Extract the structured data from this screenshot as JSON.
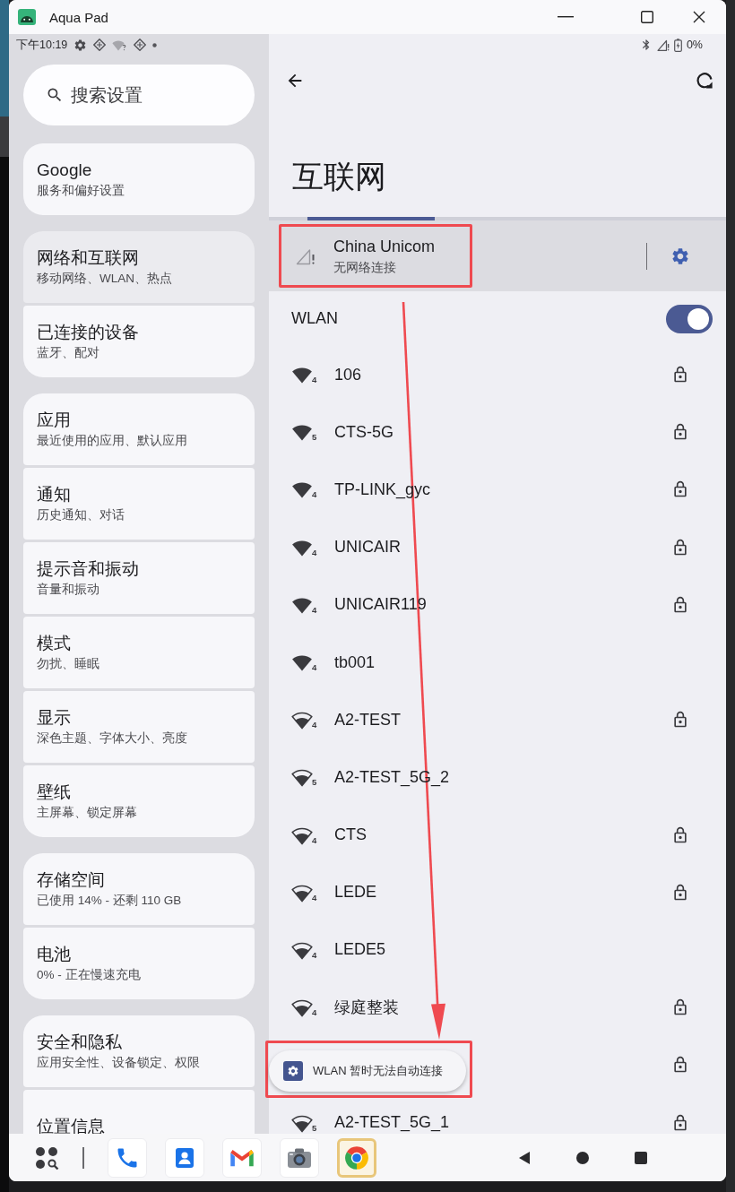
{
  "window": {
    "title": "Aqua Pad"
  },
  "status_bar": {
    "time": "下午10:19",
    "battery": "0%"
  },
  "search": {
    "placeholder": "搜索设置"
  },
  "settings_groups": [
    {
      "items": [
        {
          "title": "Google",
          "subtitle": "服务和偏好设置",
          "selected": false
        }
      ]
    },
    {
      "items": [
        {
          "title": "网络和互联网",
          "subtitle": "移动网络、WLAN、热点",
          "selected": true
        },
        {
          "title": "已连接的设备",
          "subtitle": "蓝牙、配对",
          "selected": false
        }
      ]
    },
    {
      "items": [
        {
          "title": "应用",
          "subtitle": "最近使用的应用、默认应用",
          "selected": false
        },
        {
          "title": "通知",
          "subtitle": "历史通知、对话",
          "selected": false
        },
        {
          "title": "提示音和振动",
          "subtitle": "音量和振动",
          "selected": false
        },
        {
          "title": "模式",
          "subtitle": "勿扰、睡眠",
          "selected": false
        },
        {
          "title": "显示",
          "subtitle": "深色主题、字体大小、亮度",
          "selected": false
        },
        {
          "title": "壁纸",
          "subtitle": "主屏幕、锁定屏幕",
          "selected": false
        }
      ]
    },
    {
      "items": [
        {
          "title": "存储空间",
          "subtitle": "已使用 14% - 还剩 110 GB",
          "selected": false
        },
        {
          "title": "电池",
          "subtitle": "0% - 正在慢速充电",
          "selected": false
        }
      ]
    },
    {
      "items": [
        {
          "title": "安全和隐私",
          "subtitle": "应用安全性、设备锁定、权限",
          "selected": false
        },
        {
          "title": "位置信息",
          "selected": false
        }
      ]
    }
  ],
  "page": {
    "title": "互联网",
    "scanning": true
  },
  "mobile_network": {
    "name": "China Unicom",
    "status": "无网络连接",
    "highlighted": true
  },
  "wlan": {
    "label": "WLAN",
    "on": true
  },
  "networks": [
    {
      "name": "106",
      "band": "4",
      "full_signal": true,
      "secured": true
    },
    {
      "name": "CTS-5G",
      "band": "5",
      "full_signal": true,
      "secured": true
    },
    {
      "name": "TP-LINK_gyc",
      "band": "4",
      "full_signal": true,
      "secured": true
    },
    {
      "name": "UNICAIR",
      "band": "4",
      "full_signal": true,
      "secured": true
    },
    {
      "name": "UNICAIR119",
      "band": "4",
      "full_signal": true,
      "secured": true
    },
    {
      "name": "tb001",
      "band": "4",
      "full_signal": true,
      "secured": false
    },
    {
      "name": "A2-TEST",
      "band": "4",
      "full_signal": false,
      "secured": true
    },
    {
      "name": "A2-TEST_5G_2",
      "band": "5",
      "full_signal": false,
      "secured": false
    },
    {
      "name": "CTS",
      "band": "4",
      "full_signal": false,
      "secured": true
    },
    {
      "name": "LEDE",
      "band": "4",
      "full_signal": false,
      "secured": true
    },
    {
      "name": "LEDE5",
      "band": "4",
      "full_signal": false,
      "secured": false
    },
    {
      "name": "绿庭整装",
      "band": "4",
      "full_signal": false,
      "secured": true
    },
    {
      "secured": true
    },
    {
      "name": "A2-TEST_5G_1",
      "band": "5",
      "full_signal": false,
      "secured": true
    }
  ],
  "toast": {
    "text": "WLAN 暂时无法自动连接",
    "highlighted": true
  },
  "annotation_arrow": true,
  "taskbar": {
    "apps": [
      {
        "kind": "phone",
        "selected": false
      },
      {
        "kind": "contacts",
        "selected": false
      },
      {
        "kind": "mail",
        "selected": false
      },
      {
        "kind": "camera",
        "selected": false
      },
      {
        "kind": "browser",
        "selected": true
      }
    ]
  }
}
